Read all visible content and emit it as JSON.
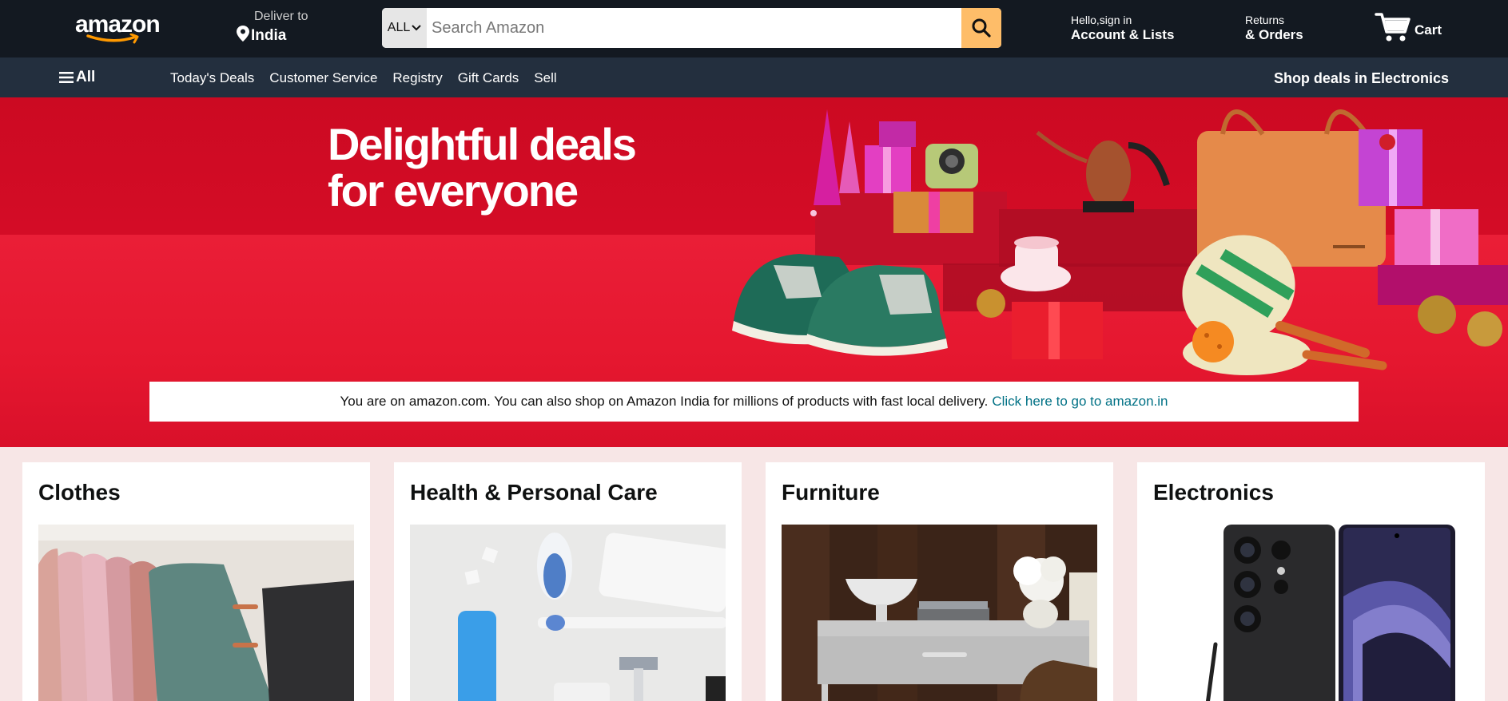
{
  "header": {
    "logo_text": "amazon",
    "deliver_label": "Deliver to",
    "deliver_location": "India",
    "search": {
      "category": "ALL",
      "placeholder": "Search Amazon"
    },
    "account_line1": "Hello,sign in",
    "account_line2": "Account & Lists",
    "returns_line1": "Returns",
    "returns_line2": "& Orders",
    "cart_label": "Cart"
  },
  "subnav": {
    "all_label": "All",
    "items": [
      "Today's Deals",
      "Customer Service",
      "Registry",
      "Gift Cards",
      "Sell"
    ],
    "promo": "Shop deals in Electronics"
  },
  "hero": {
    "headline_line1": "Delightful deals",
    "headline_line2": "for everyone",
    "notice_text": "You are on amazon.com. You can also shop on Amazon India for millions of products with fast local delivery.",
    "notice_link": "Click here to go to amazon.in"
  },
  "cards": [
    {
      "title": "Clothes"
    },
    {
      "title": "Health & Personal Care"
    },
    {
      "title": "Furniture"
    },
    {
      "title": "Electronics"
    }
  ],
  "colors": {
    "nav_bg": "#131921",
    "subnav_bg": "#232f3e",
    "search_button": "#febd69",
    "hero_red": "#e0142e",
    "link": "#007185",
    "page_bg": "#f7e6e6"
  }
}
